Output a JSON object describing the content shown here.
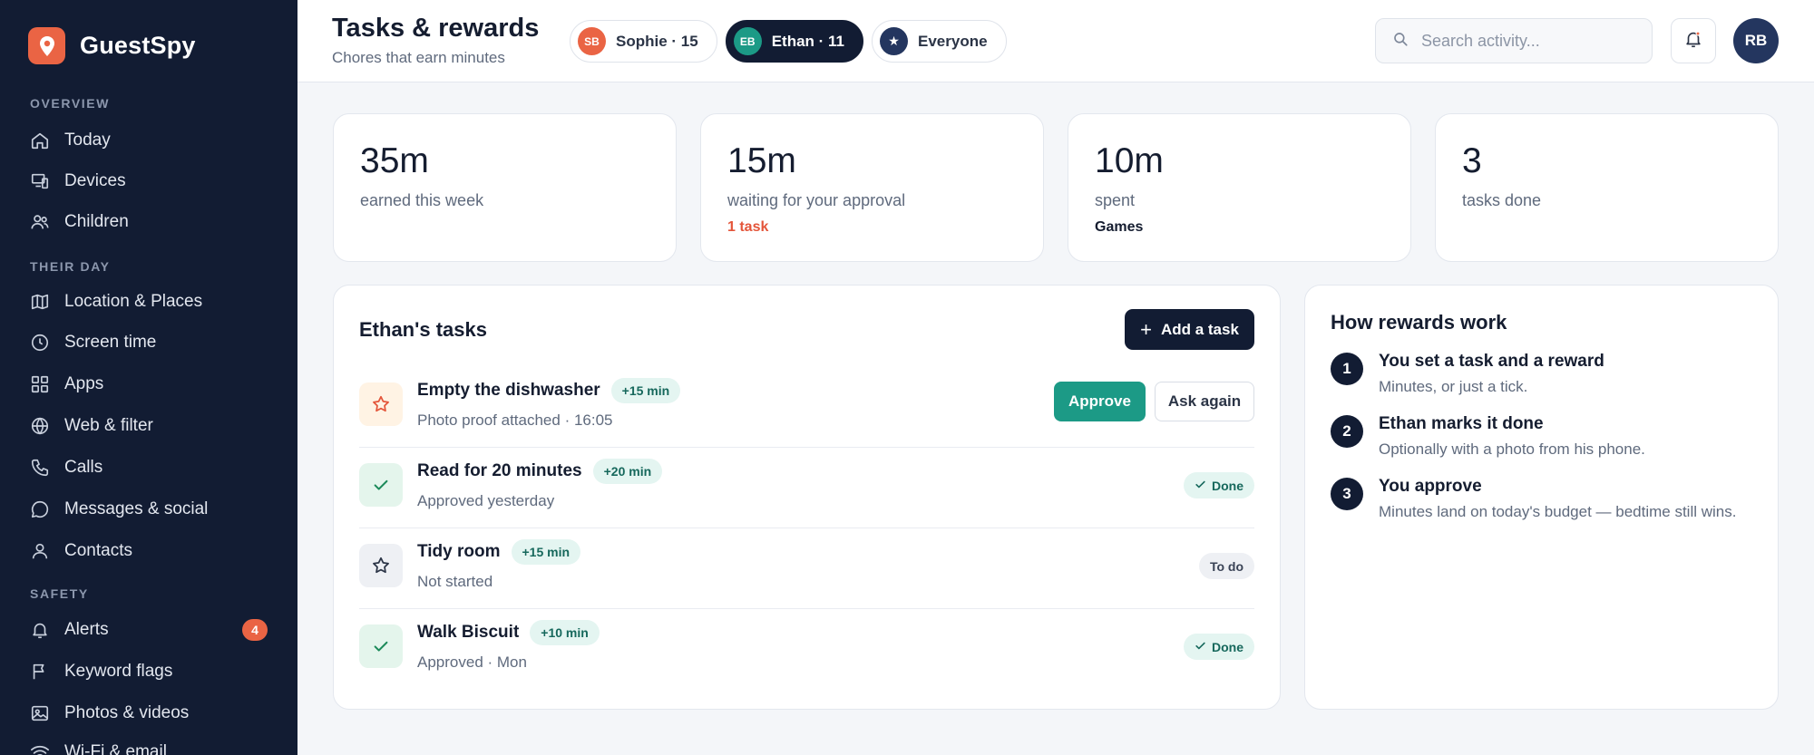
{
  "brand": {
    "name": "GuestSpy",
    "accent": "#ea6444"
  },
  "sidebar": {
    "sections": [
      {
        "label": "OVERVIEW"
      },
      {
        "label": "THEIR DAY"
      },
      {
        "label": "SAFETY"
      }
    ],
    "items": [
      {
        "label": "Today",
        "icon": "home-icon"
      },
      {
        "label": "Devices",
        "icon": "devices-icon"
      },
      {
        "label": "Children",
        "icon": "users-icon"
      },
      {
        "label": "Location & Places",
        "icon": "map-icon"
      },
      {
        "label": "Screen time",
        "icon": "clock-icon"
      },
      {
        "label": "Apps",
        "icon": "grid-icon"
      },
      {
        "label": "Web & filter",
        "icon": "globe-icon"
      },
      {
        "label": "Calls",
        "icon": "phone-icon"
      },
      {
        "label": "Messages & social",
        "icon": "chat-icon"
      },
      {
        "label": "Contacts",
        "icon": "user-icon"
      },
      {
        "label": "Alerts",
        "icon": "bell-icon",
        "badge": "4"
      },
      {
        "label": "Keyword flags",
        "icon": "flag-icon"
      },
      {
        "label": "Photos & videos",
        "icon": "image-icon"
      },
      {
        "label": "Wi-Fi & email",
        "icon": "wifi-icon"
      }
    ]
  },
  "header": {
    "title": "Tasks & rewards",
    "subtitle": "Chores that earn minutes",
    "chips": [
      {
        "initials": "SB",
        "label": "Sophie · 15",
        "color": "#ea6444"
      },
      {
        "initials": "EB",
        "label": "Ethan · 11",
        "color": "#1c9a86"
      },
      {
        "initials": "★",
        "label": "Everyone",
        "color": "#24365f"
      }
    ],
    "search_placeholder": "Search activity...",
    "avatar_initials": "RB"
  },
  "stats": [
    {
      "value": "35m",
      "label": "earned this week",
      "sub": ""
    },
    {
      "value": "15m",
      "label": "waiting for your approval",
      "sub": "1 task",
      "sub_color": "#e4553a"
    },
    {
      "value": "10m",
      "label": "spent",
      "sub": "Games",
      "sub_color": "#151d30"
    },
    {
      "value": "3",
      "label": "tasks done",
      "sub": ""
    }
  ],
  "tasks_panel": {
    "title": "Ethan's tasks",
    "add_label": "Add a task",
    "approve_label": "Approve",
    "ask_again_label": "Ask again",
    "tasks": [
      {
        "title": "Empty the dishwasher",
        "reward": "+15 min",
        "meta": "Photo proof attached · 16:05",
        "state": "pending"
      },
      {
        "title": "Read for 20 minutes",
        "reward": "+20 min",
        "meta": "Approved yesterday",
        "state": "done",
        "status": "Done"
      },
      {
        "title": "Tidy room",
        "reward": "+15 min",
        "meta": "Not started",
        "state": "todo",
        "status": "To do"
      },
      {
        "title": "Walk Biscuit",
        "reward": "+10 min",
        "meta": "Approved · Mon",
        "state": "done",
        "status": "Done"
      }
    ]
  },
  "rewards_panel": {
    "title": "How rewards work",
    "steps": [
      {
        "num": "1",
        "title": "You set a task and a reward",
        "desc": "Minutes, or just a tick."
      },
      {
        "num": "2",
        "title": "Ethan marks it done",
        "desc": "Optionally with a photo from his phone."
      },
      {
        "num": "3",
        "title": "You approve",
        "desc": "Minutes land on today's budget — bedtime still wins."
      }
    ]
  }
}
